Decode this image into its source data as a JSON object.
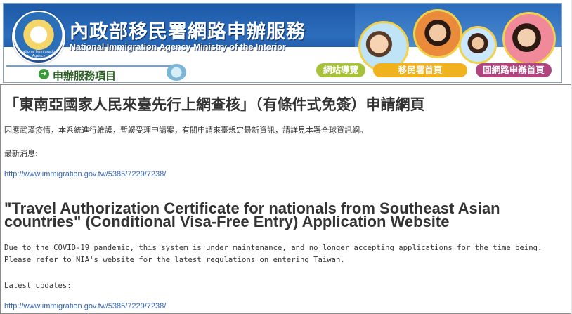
{
  "header": {
    "title_zh": "內政部移民署網路申辦服務",
    "title_en": "National Immigration Agency Ministry of the Interior",
    "seal_text": "National Immigration Agency",
    "menu_label": "申辦服務項目",
    "nav": {
      "site_map": "網站導覽",
      "nia_home": "移民署首頁",
      "online_home": "回網路申辦首頁"
    },
    "colors": {
      "banner": "#1d5aa8",
      "site_map": "#a7c23a",
      "nia_home": "#f0b21e",
      "online_home": "#b0447f"
    }
  },
  "content": {
    "heading_zh": "「東南亞國家人民來臺先行上網查核」（有條件式免簽）申請網頁",
    "notice_zh": "因應武漢疫情，本系統進行維護，暫緩受理申請案，有關申請來臺規定最新資訊，請詳見本署全球資訊網。",
    "latest_label_zh": "最新消息:",
    "link_zh": "http://www.immigration.gov.tw/5385/7229/7238/",
    "heading_en": "\"Travel Authorization Certificate for nationals from Southeast Asian countries\" (Conditional Visa-Free Entry) Application Website",
    "notice_en": "Due to the COVID-19 pandemic, this system is under maintenance, and no longer accepting applications for the time being.\nPlease refer to NIA's website for the latest regulations on entering Taiwan.",
    "latest_label_en": "Latest updates:",
    "link_en": "http://www.immigration.gov.tw/5385/7229/7238/",
    "colors": {
      "link": "#3366bb",
      "text": "#333333"
    }
  }
}
